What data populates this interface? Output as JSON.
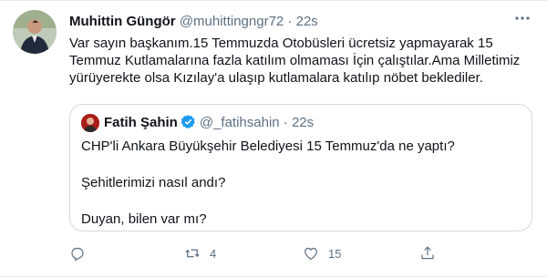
{
  "tweet": {
    "author": {
      "name": "Muhittin Güngör",
      "handle": "@muhittingngr72",
      "separator": "·",
      "time": "22s"
    },
    "text": "Var sayın başkanım.15 Temmuzda Otobüsleri ücretsiz yapmayarak 15 Temmuz Kutlamalarına fazla katılım olmaması İçin çalıştılar.Ama Milletimiz yürüyerekte olsa Kızılay'a ulaşıp kutlamalara katılıp nöbet beklediler.",
    "more_icon": "more-icon"
  },
  "quoted": {
    "author": {
      "name": "Fatih Şahin",
      "handle": "@_fatihsahin",
      "separator": "·",
      "time": "22s",
      "verified": true
    },
    "lines": [
      "CHP'li Ankara Büyükşehir Belediyesi 15 Temmuz'da ne yaptı?",
      "Şehitlerimizi nasıl andı?",
      "Duyan, bilen var mı?"
    ]
  },
  "actions": {
    "reply": {
      "icon": "reply-icon",
      "count": ""
    },
    "retweet": {
      "icon": "retweet-icon",
      "count": "4"
    },
    "like": {
      "icon": "heart-icon",
      "count": "15"
    },
    "share": {
      "icon": "share-icon",
      "count": ""
    }
  },
  "colors": {
    "text": "#0f1419",
    "secondary": "#5b7083",
    "border": "#cfd9de",
    "verified": "#1d9bf0"
  }
}
